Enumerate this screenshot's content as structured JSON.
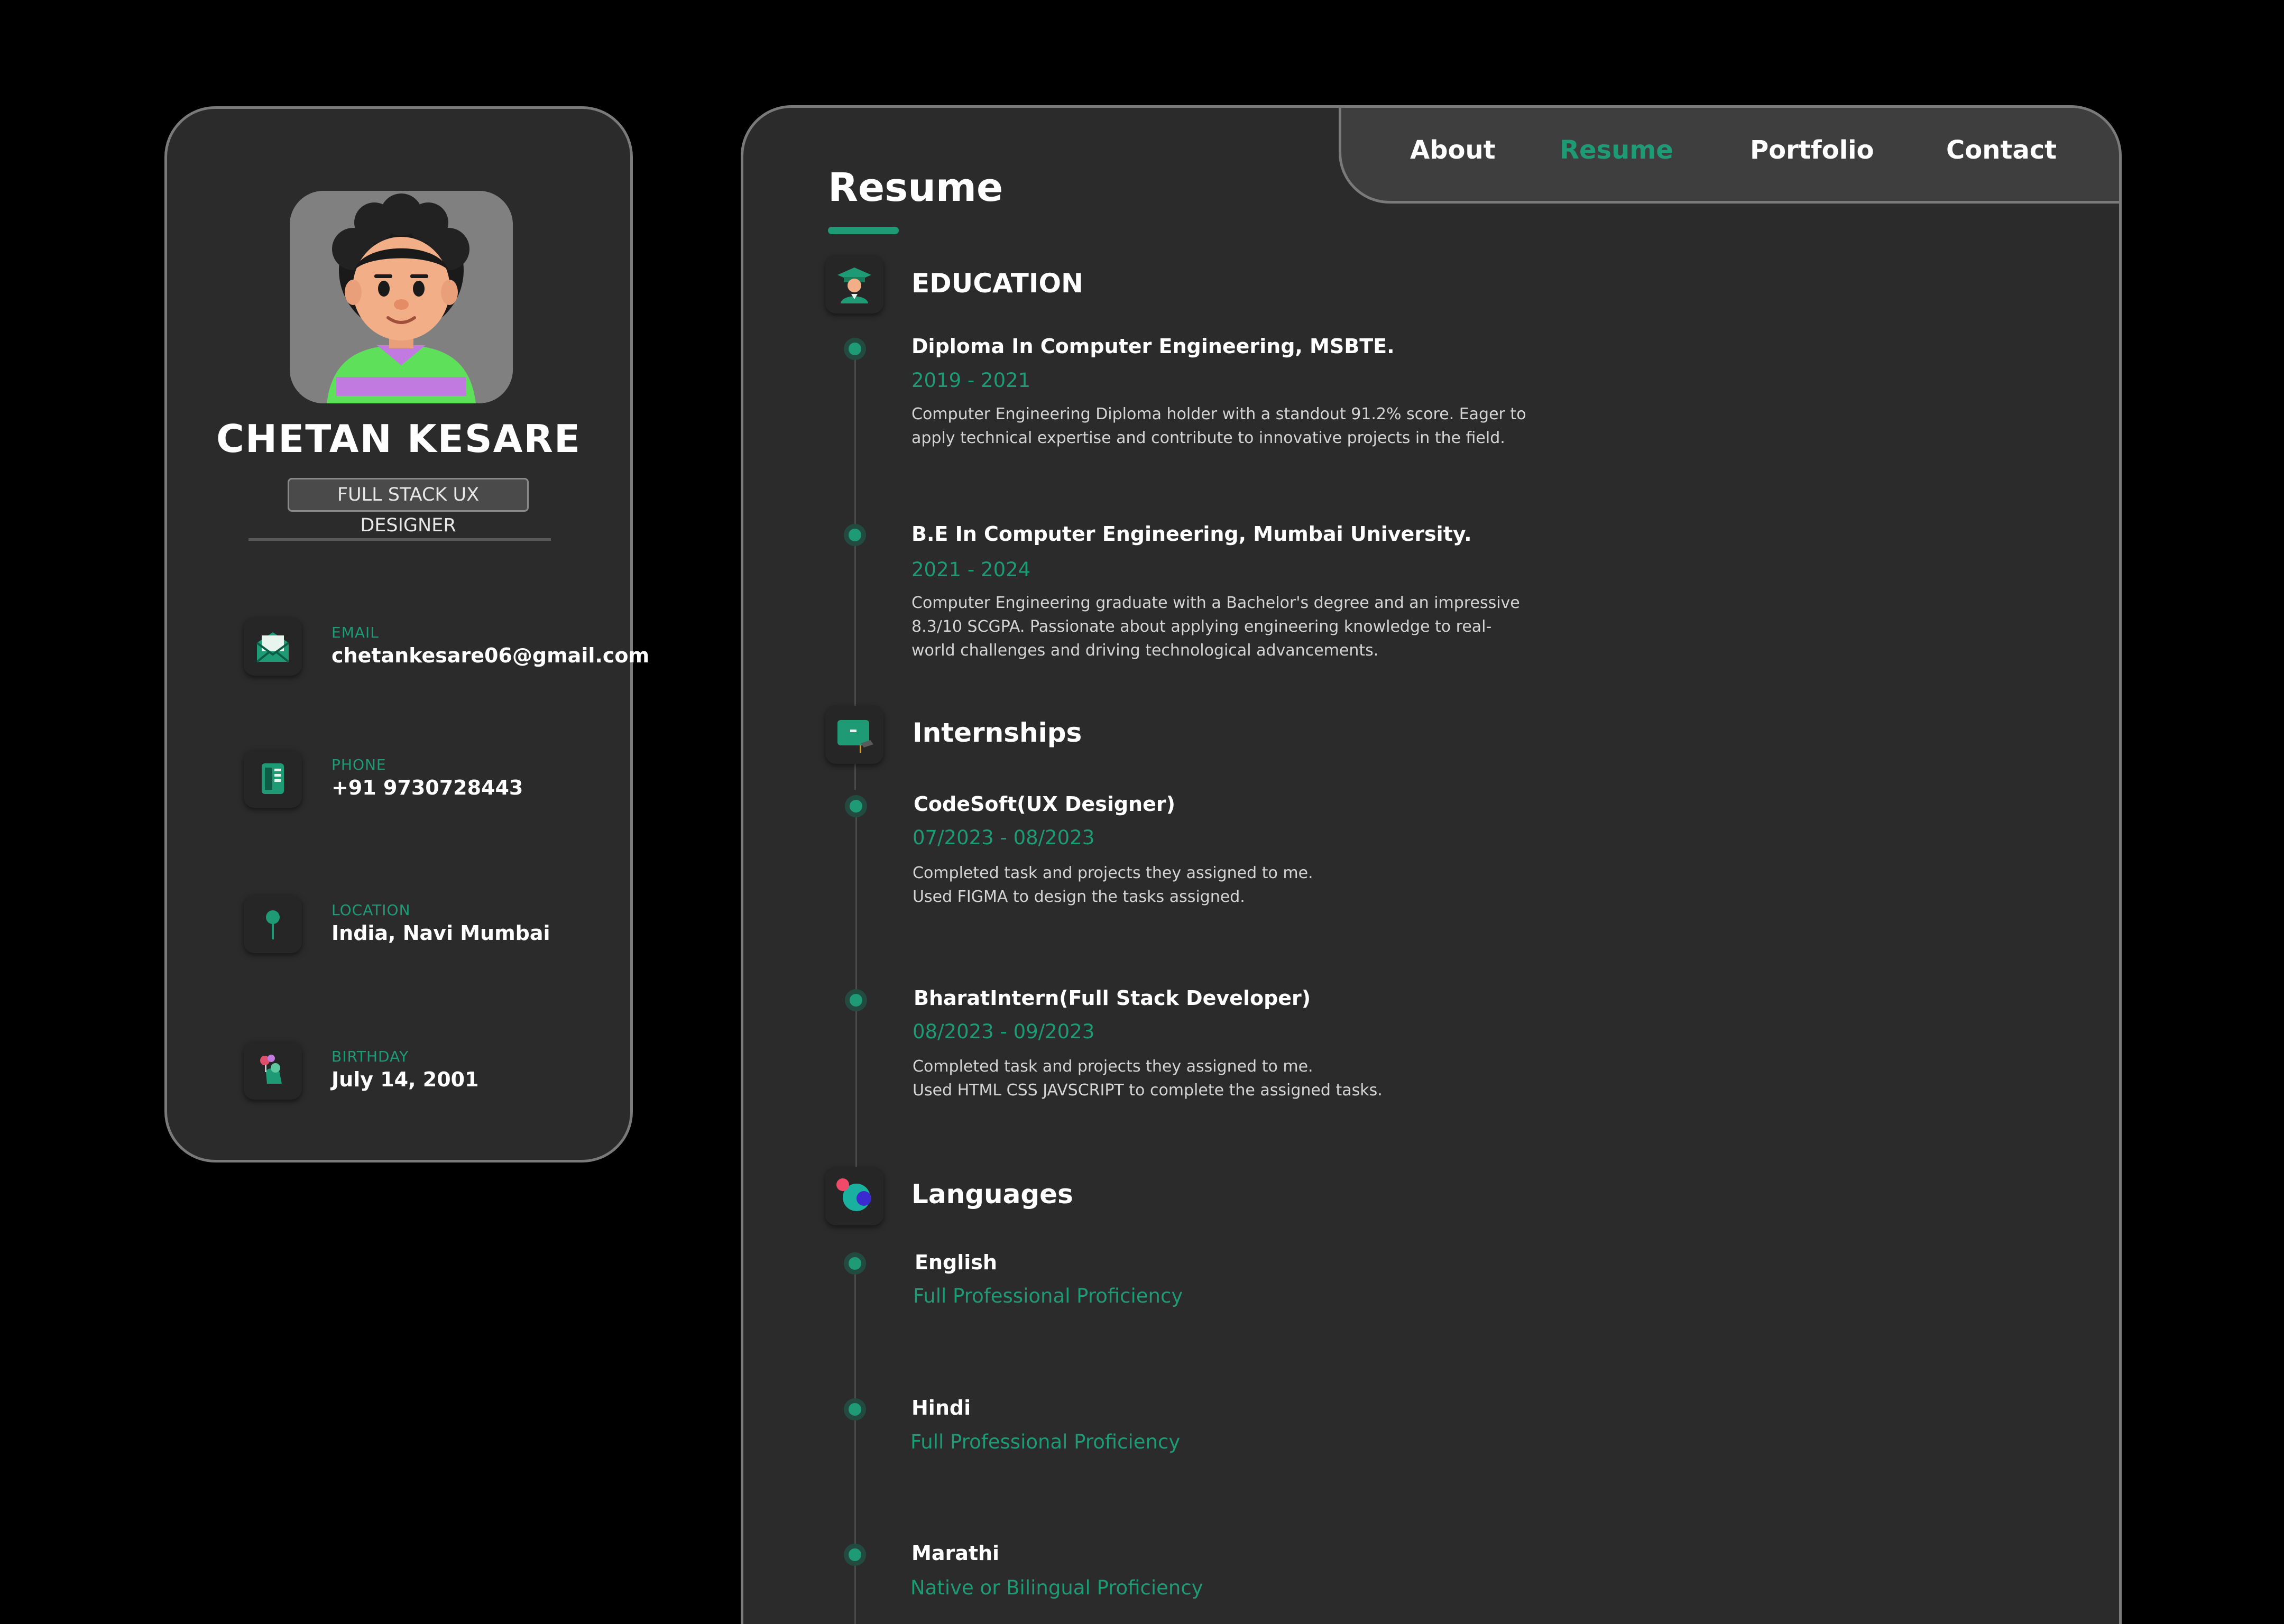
{
  "profile": {
    "name": "CHETAN KESARE",
    "title": "FULL STACK UX DESIGNER"
  },
  "contacts": [
    {
      "label": "EMAIL",
      "value": "chetankesare06@gmail.com",
      "icon": "mail-icon"
    },
    {
      "label": "PHONE",
      "value": "+91  9730728443",
      "icon": "phone-icon"
    },
    {
      "label": "LOCATION",
      "value": "India, Navi Mumbai",
      "icon": "location-pin-icon"
    },
    {
      "label": "BIRTHDAY",
      "value": "July 14, 2001",
      "icon": "birthday-icon"
    }
  ],
  "nav": {
    "items": [
      "About",
      "Resume",
      "Portfolio",
      "Contact"
    ],
    "active": "Resume"
  },
  "page_title": "Resume",
  "education": {
    "heading": "EDUCATION",
    "items": [
      {
        "title": "Diploma In Computer Engineering, MSBTE.",
        "date": "2019 - 2021",
        "desc": [
          "Computer Engineering Diploma holder with a standout 91.2% score. Eager to",
          "apply technical expertise and contribute to innovative projects in the field."
        ]
      },
      {
        "title": "B.E In Computer Engineering, Mumbai University.",
        "date": "2021 - 2024",
        "desc": [
          "Computer Engineering graduate with a Bachelor's degree and an impressive",
          "8.3/10 SCGPA. Passionate about applying engineering knowledge to real-",
          "world challenges and driving technological advancements."
        ]
      }
    ]
  },
  "internships": {
    "heading": "Internships",
    "items": [
      {
        "title": "CodeSoft(UX Designer)",
        "date": "07/2023 - 08/2023",
        "desc": [
          "Completed task and projects they assigned to me.",
          "Used FIGMA to design the tasks assigned."
        ]
      },
      {
        "title": "BharatIntern(Full Stack Developer)",
        "date": "08/2023 - 09/2023",
        "desc": [
          "Completed task and projects they assigned to me.",
          "Used HTML CSS JAVSCRIPT to complete the assigned tasks."
        ]
      }
    ]
  },
  "languages": {
    "heading": "Languages",
    "items": [
      {
        "title": "English",
        "level": "Full Professional Proficiency"
      },
      {
        "title": "Hindi",
        "level": "Full Professional Proficiency"
      },
      {
        "title": "Marathi",
        "level": "Native or Bilingual Proficiency"
      }
    ]
  },
  "colors": {
    "accent": "#1e9a75",
    "panel": "#2b2b2b",
    "background": "#000000",
    "border": "#7a7a7a"
  }
}
